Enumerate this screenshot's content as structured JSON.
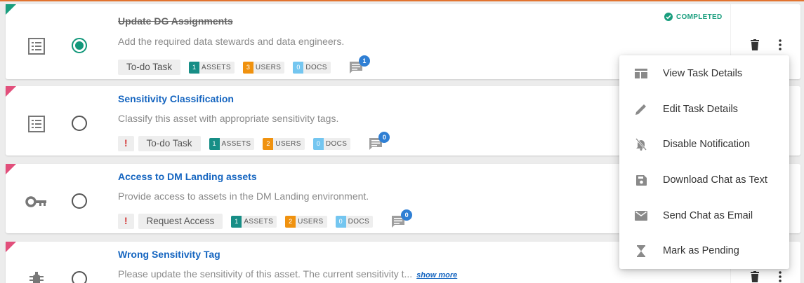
{
  "tasks": [
    {
      "title": "Update DG Assignments",
      "description": "Add the required data stewards and data engineers.",
      "show_more": "",
      "type_label": "To-do Task",
      "icon": "list-icon",
      "priority": "",
      "assets": "1",
      "assets_label": "ASSETS",
      "users": "3",
      "users_label": "USERS",
      "docs": "0",
      "docs_label": "DOCS",
      "comments": "1",
      "status": "COMPLETED",
      "selected": true
    },
    {
      "title": "Sensitivity Classification",
      "description": "Classify this asset with appropriate sensitivity tags.",
      "show_more": "",
      "type_label": "To-do Task",
      "icon": "list-icon",
      "priority": "!",
      "assets": "1",
      "assets_label": "ASSETS",
      "users": "2",
      "users_label": "USERS",
      "docs": "0",
      "docs_label": "DOCS",
      "comments": "0",
      "selected": false
    },
    {
      "title": "Access to DM Landing assets",
      "description": "Provide access to assets in the DM Landing environment.",
      "show_more": "",
      "type_label": "Request Access",
      "icon": "key-icon",
      "priority": "!",
      "assets": "1",
      "assets_label": "ASSETS",
      "users": "2",
      "users_label": "USERS",
      "docs": "0",
      "docs_label": "DOCS",
      "comments": "0",
      "selected": false
    },
    {
      "title": "Wrong Sensitivity Tag",
      "description": "Please update the sensitivity of this asset. The current sensitivity t...",
      "show_more": "show more",
      "icon": "bug-icon",
      "selected": false
    }
  ],
  "context_menu": {
    "items": [
      {
        "label": "View Task Details",
        "icon": "table-icon"
      },
      {
        "label": "Edit Task Details",
        "icon": "pencil-icon"
      },
      {
        "label": "Disable Notification",
        "icon": "bell-off-icon"
      },
      {
        "label": "Download Chat as Text",
        "icon": "save-icon"
      },
      {
        "label": "Send Chat as Email",
        "icon": "mail-icon"
      },
      {
        "label": "Mark as Pending",
        "icon": "hourglass-icon"
      }
    ]
  },
  "colors": {
    "accent_top": "#e2732f",
    "completed": "#1a9e7e",
    "priority_corner": "#e24f7b",
    "link": "#1565c0",
    "assets_badge": "#178e86",
    "users_badge": "#f0920f",
    "docs_badge": "#74c6f0",
    "comment_badge": "#2f7fd4"
  }
}
